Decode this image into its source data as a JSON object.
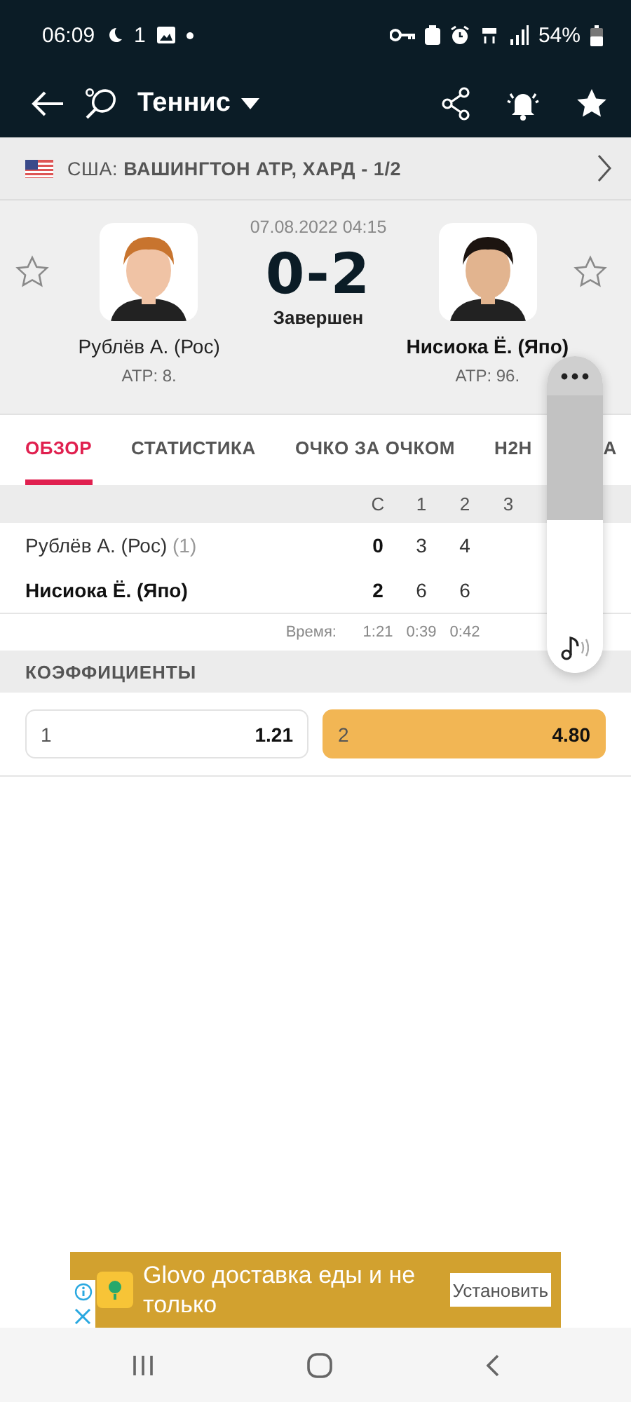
{
  "status_bar": {
    "time": "06:09",
    "temperature": "1",
    "battery": "54%"
  },
  "app_bar": {
    "sport": "Теннис"
  },
  "tournament": {
    "country": "США:",
    "name": "ВАШИНГТОН ATP, ХАРД - 1/2"
  },
  "match": {
    "datetime": "07.08.2022 04:15",
    "score": "0-2",
    "status": "Завершен",
    "players": [
      {
        "name": "Рублёв А. (Рос)",
        "rank": "ATP: 8.",
        "winner": false
      },
      {
        "name": "Нисиока Ё. (Япо)",
        "rank": "ATP: 96.",
        "winner": true
      }
    ]
  },
  "tabs": [
    {
      "label": "ОБЗОР",
      "selected": true
    },
    {
      "label": "СТАТИСТИКА",
      "selected": false
    },
    {
      "label": "ОЧКО ЗА ОЧКОМ",
      "selected": false
    },
    {
      "label": "H2H",
      "selected": false
    },
    {
      "label": "А",
      "selected": false
    }
  ],
  "score_table": {
    "columns": [
      "С",
      "1",
      "2",
      "3"
    ],
    "rows": [
      {
        "player": "Рублёв А. (Рос)",
        "seed": "(1)",
        "winner": false,
        "cells": [
          "0",
          "3",
          "4"
        ]
      },
      {
        "player": "Нисиока Ё. (Япо)",
        "winner": true,
        "cells": [
          "2",
          "6",
          "6"
        ]
      }
    ],
    "time_label": "Время:",
    "times": [
      "1:21",
      "0:39",
      "0:42"
    ]
  },
  "odds": {
    "title": "КОЭФФИЦИЕНТЫ",
    "items": [
      {
        "label": "1",
        "value": "1.21",
        "selected": false
      },
      {
        "label": "2",
        "value": "4.80",
        "selected": true
      }
    ]
  },
  "volume": {
    "level": 0.45
  },
  "ad": {
    "text": "Glovo доставка еды и не только",
    "button": "Установить"
  }
}
